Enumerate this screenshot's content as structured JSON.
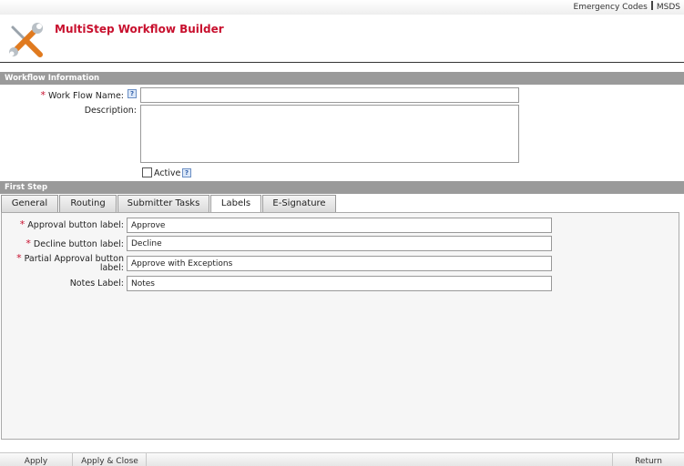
{
  "top_links": {
    "emergency_codes": "Emergency Codes",
    "msds": "MSDS"
  },
  "header": {
    "title": "MultiStep Workflow Builder",
    "logo_icon": "wrench-screwdriver-icon",
    "title_color": "#c8102e"
  },
  "workflow_info": {
    "section_title": "Workflow Information",
    "name_label": "Work Flow Name:",
    "name_value": "",
    "description_label": "Description:",
    "description_value": "",
    "active_label": "Active",
    "active_checked": false,
    "help_glyph": "?"
  },
  "first_step": {
    "section_title": "First Step",
    "tabs": [
      {
        "label": "General"
      },
      {
        "label": "Routing"
      },
      {
        "label": "Submitter Tasks"
      },
      {
        "label": "Labels"
      },
      {
        "label": "E-Signature"
      }
    ],
    "active_tab": "Labels",
    "fields": {
      "approval_label": "Approval button label:",
      "approval_value": "Approve",
      "decline_label": "Decline button label:",
      "decline_value": "Decline",
      "partial_label_line1": "Partial Approval button",
      "partial_label_line2": "label:",
      "partial_value": "Approve with Exceptions",
      "notes_label": "Notes Label:",
      "notes_value": "Notes"
    }
  },
  "footer": {
    "apply": "Apply",
    "apply_close": "Apply & Close",
    "return": "Return"
  },
  "colors": {
    "section_bar": "#9a9a9a",
    "required_star": "#c8102e"
  }
}
